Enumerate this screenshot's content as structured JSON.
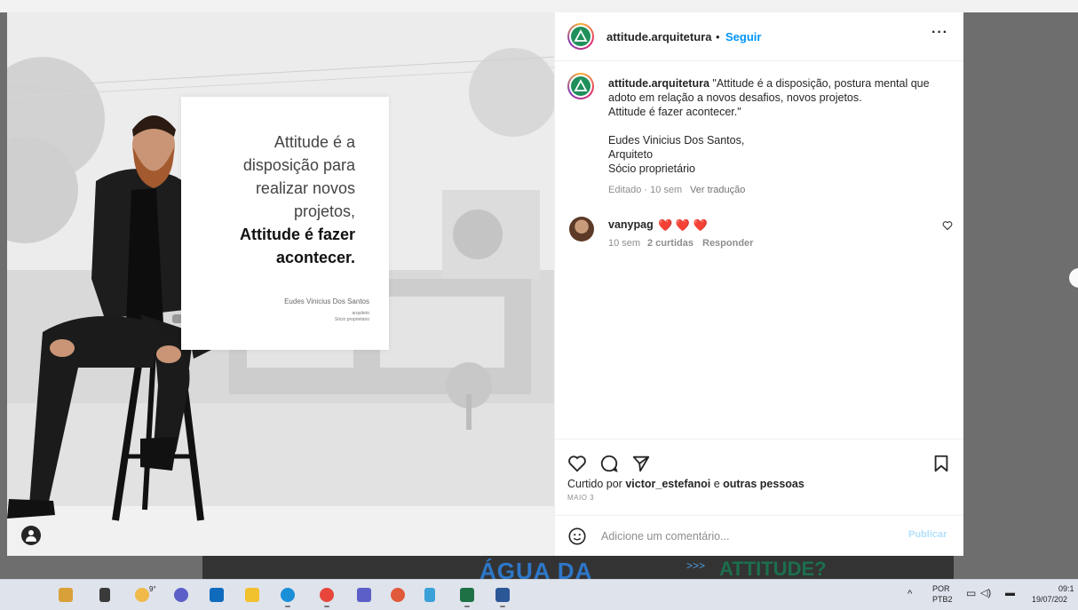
{
  "post": {
    "quote": {
      "line1": "Attitude é a",
      "line2": "disposição para",
      "line3": "realizar novos",
      "line4": "projetos,",
      "line5": "Attitude é fazer",
      "line6": "acontecer.",
      "signature": "Eudes Vinicius Dos Santos",
      "sub1": "arquiteto",
      "sub2": "Sócio proprietário"
    }
  },
  "header": {
    "username": "attitude.arquitetura",
    "separator": "•",
    "follow_label": "Seguir",
    "more_label": "···"
  },
  "caption": {
    "username": "attitude.arquitetura",
    "lines": [
      "\"Attitude é a disposição, postura mental que",
      "adoto em relação a novos desafios, novos projetos.",
      "Attitude é fazer acontecer.\"",
      "",
      "Eudes Vinicius Dos Santos,",
      "Arquiteto",
      "Sócio proprietário"
    ],
    "edited": "Editado · 10 sem",
    "translate": "Ver tradução"
  },
  "comment": {
    "username": "vanypag",
    "text": "❤️ ❤️ ❤️",
    "time": "10 sem",
    "likes": "2 curtidas",
    "reply": "Responder"
  },
  "likes": {
    "prefix": "Curtido por",
    "user": "victor_estefanoi",
    "conj": "e",
    "others": "outras pessoas"
  },
  "date": "MAIO 3",
  "comment_box": {
    "placeholder": "Adicione um comentário...",
    "publish_label": "Publicar"
  },
  "background_peek": {
    "text1": "ÁGUA DA",
    "chevrons": ">>>",
    "text2": "ATTITUDE?"
  },
  "taskbar": {
    "weather": "9°",
    "lang1": "POR",
    "lang2": "PTB2",
    "time": "09:1",
    "date": "19/07/202"
  }
}
